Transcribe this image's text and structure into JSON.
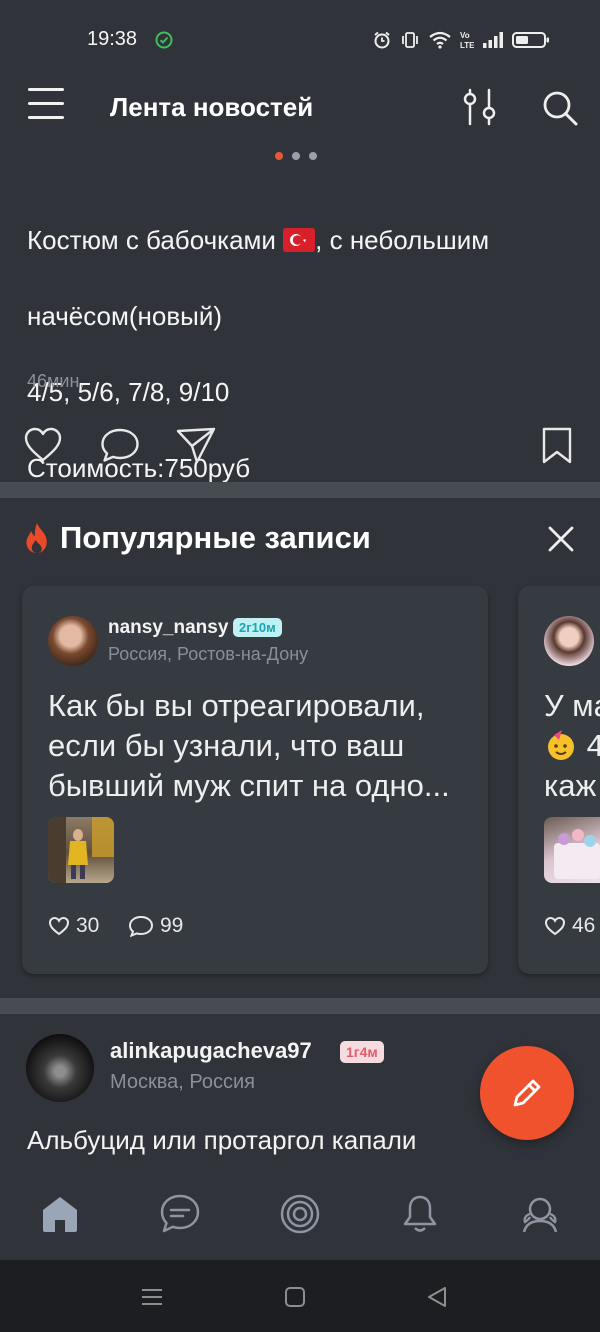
{
  "status_bar": {
    "time": "19:38",
    "icons": [
      "alarm-icon",
      "vibrate-icon",
      "wifi-icon",
      "volte-icon",
      "signal-icon",
      "battery-icon"
    ]
  },
  "header": {
    "title": "Лента новостей",
    "icons": [
      "menu-icon",
      "filter-icon",
      "search-icon"
    ]
  },
  "carousel": {
    "dots": 3,
    "active": 0
  },
  "post": {
    "line1a": "Костюм с бабочками ",
    "line1b": ", с небольшим",
    "line2": "начёсом(новый)",
    "line3": "4/5, 5/6, 7/8, 9/10",
    "line4": "Стоимость:750руб",
    "time": "46мин.",
    "actions": [
      "heart-icon",
      "comment-icon",
      "share-icon",
      "bookmark-icon"
    ]
  },
  "popular": {
    "title": "Популярные записи",
    "cards": [
      {
        "username": "nansy_nansy",
        "badge": "2г10м",
        "location": "Россия, Ростов-на-Дону",
        "text_line1": "Как бы вы отреагировали,",
        "text_line2": "если бы узнали, что ваш",
        "text_line3": "бывший муж спит на одно...",
        "likes": "30",
        "comments": "99"
      },
      {
        "text_line1": "У ма",
        "text_line2": " 4",
        "text_line3": "каж",
        "likes": "46"
      }
    ]
  },
  "next_post": {
    "username": "alinkapugacheva97",
    "badge": "1г4м",
    "location": "Москва, Россия",
    "text": "Альбуцид или протаргол капали"
  },
  "bottom_nav": [
    "home-icon",
    "messages-icon",
    "target-icon",
    "bell-icon",
    "profile-icon"
  ],
  "colors": {
    "accent": "#f0522d",
    "background": "#30343a",
    "card": "#363a41",
    "badge_blue": "#bff0f2",
    "badge_pink": "#f7dcdf"
  }
}
